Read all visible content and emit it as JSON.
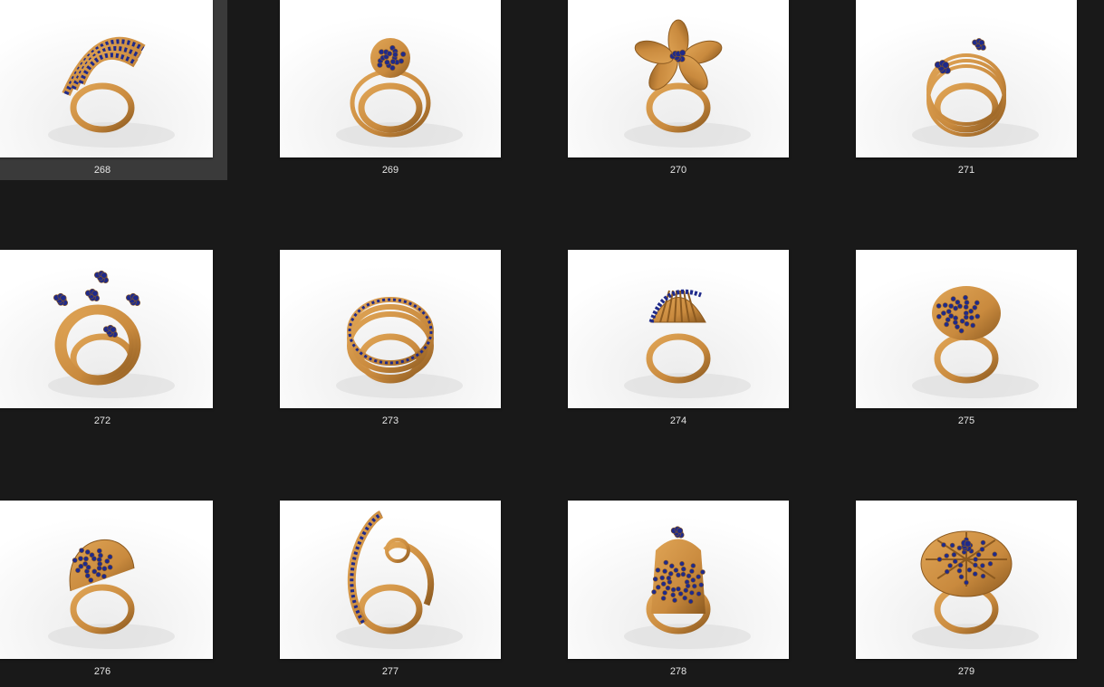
{
  "colors": {
    "background": "#191919",
    "selected_tile": "#3a3a3a",
    "caption_text": "#e6e6e6",
    "gold": "#c98a3e",
    "gold_dark": "#8c5a20",
    "sapphire": "#1f2a8a"
  },
  "items": [
    {
      "label": "268",
      "selected": true,
      "motif": "wave-bands"
    },
    {
      "label": "269",
      "selected": false,
      "motif": "round-cluster"
    },
    {
      "label": "270",
      "selected": false,
      "motif": "flower"
    },
    {
      "label": "271",
      "selected": false,
      "motif": "triple-band-flowers"
    },
    {
      "label": "272",
      "selected": false,
      "motif": "multi-flowers"
    },
    {
      "label": "273",
      "selected": false,
      "motif": "twin-bands"
    },
    {
      "label": "274",
      "selected": false,
      "motif": "shell"
    },
    {
      "label": "275",
      "selected": false,
      "motif": "pave-dome"
    },
    {
      "label": "276",
      "selected": false,
      "motif": "swirl"
    },
    {
      "label": "277",
      "selected": false,
      "motif": "open-swirl"
    },
    {
      "label": "278",
      "selected": false,
      "motif": "pave-shield"
    },
    {
      "label": "279",
      "selected": false,
      "motif": "flower-dome"
    }
  ]
}
